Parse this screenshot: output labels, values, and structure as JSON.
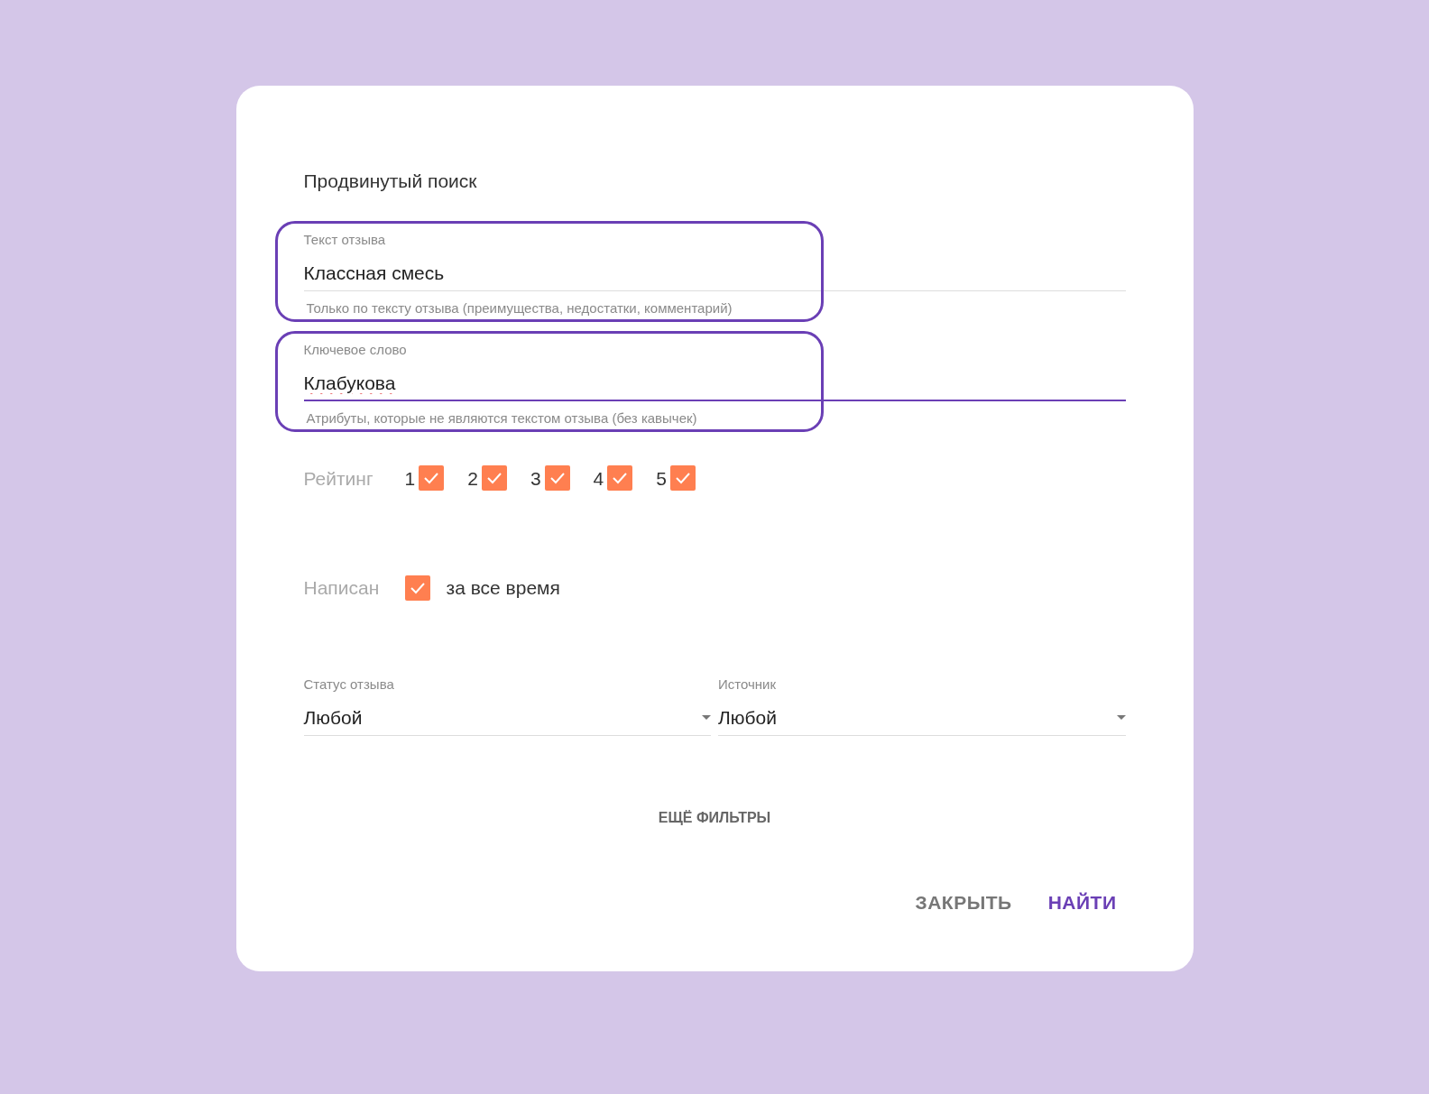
{
  "dialog": {
    "title": "Продвинутый поиск",
    "fields": [
      {
        "label": "Текст отзыва",
        "value": "Классная смесь",
        "helper": "Только по тексту отзыва (преимущества, недостатки, комментарий)",
        "focused": false,
        "highlighted": true,
        "spelling_error": false
      },
      {
        "label": "Ключевое слово",
        "value": "Клабукова",
        "helper": "Атрибуты, которые не являются текстом отзыва (без кавычек)",
        "focused": true,
        "highlighted": true,
        "spelling_error": true
      }
    ],
    "rating": {
      "label": "Рейтинг",
      "options": [
        {
          "label": "1",
          "checked": true
        },
        {
          "label": "2",
          "checked": true
        },
        {
          "label": "3",
          "checked": true
        },
        {
          "label": "4",
          "checked": true
        },
        {
          "label": "5",
          "checked": true
        }
      ]
    },
    "written": {
      "label": "Написан",
      "option": {
        "label": "за все время",
        "checked": true
      }
    },
    "selects": [
      {
        "label": "Статус отзыва",
        "value": "Любой"
      },
      {
        "label": "Источник",
        "value": "Любой"
      }
    ],
    "more_filters": "ЕЩЁ ФИЛЬТРЫ",
    "buttons": [
      {
        "label": "ЗАКРЫТЬ",
        "kind": "secondary"
      },
      {
        "label": "НАЙТИ",
        "kind": "primary"
      }
    ]
  }
}
